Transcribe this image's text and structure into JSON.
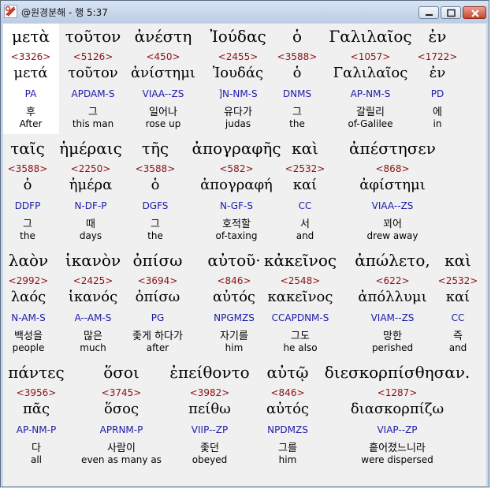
{
  "window": {
    "title": "@원경분해 - 행 5:37"
  },
  "rows": [
    [
      {
        "greek": "μετὰ",
        "strong": "<3326>",
        "lemma": "μετά",
        "pos": "PA",
        "korean": "후",
        "english": "After"
      },
      {
        "greek": "τοῦτον",
        "strong": "<5126>",
        "lemma": "τοῦτον",
        "pos": "APDAM-S",
        "korean": "그",
        "english": "this man"
      },
      {
        "greek": "ἀνέστη",
        "strong": "<450>",
        "lemma": "ἀνίστημι",
        "pos": "VIAA--ZS",
        "korean": "일어나",
        "english": "rose up"
      },
      {
        "greek": "Ἰούδας",
        "strong": "<2455>",
        "lemma": "Ἰουδάς",
        "pos": "]N-NM-S",
        "korean": "유다가",
        "english": "judas"
      },
      {
        "greek": "ὁ",
        "strong": "<3588>",
        "lemma": "ὁ",
        "pos": "DNMS",
        "korean": "그",
        "english": "the"
      },
      {
        "greek": "Γαλιλαῖος",
        "strong": "<1057>",
        "lemma": "Γαλιλαῖος",
        "pos": "AP-NM-S",
        "korean": "갈릴리",
        "english": "of-Galilee"
      },
      {
        "greek": "ἐν",
        "strong": "<1722>",
        "lemma": "ἐν",
        "pos": "PD",
        "korean": "에",
        "english": "in"
      }
    ],
    [
      {
        "greek": "ταῖς",
        "strong": "<3588>",
        "lemma": "ὁ",
        "pos": "DDFP",
        "korean": "그",
        "english": "the"
      },
      {
        "greek": "ἡμέραις",
        "strong": "<2250>",
        "lemma": "ἡμέρα",
        "pos": "N-DF-P",
        "korean": "때",
        "english": "days"
      },
      {
        "greek": "τῆς",
        "strong": "<3588>",
        "lemma": "ὁ",
        "pos": "DGFS",
        "korean": "그",
        "english": "the"
      },
      {
        "greek": "ἀπογραφῆς",
        "strong": "<582>",
        "lemma": "ἀπογραφή",
        "pos": "N-GF-S",
        "korean": "호적할",
        "english": "of-taxing"
      },
      {
        "greek": "καὶ",
        "strong": "<2532>",
        "lemma": "καί",
        "pos": "CC",
        "korean": "서",
        "english": "and"
      },
      {
        "greek": "ἀπέστησεν",
        "strong": "<868>",
        "lemma": "ἀφίστημι",
        "pos": "VIAA--ZS",
        "korean": "꾀어",
        "english": "drew away"
      }
    ],
    [
      {
        "greek": "λαὸν",
        "strong": "<2992>",
        "lemma": "λαός",
        "pos": "N-AM-S",
        "korean": "백성을",
        "english": "people"
      },
      {
        "greek": "ἱκανὸν",
        "strong": "<2425>",
        "lemma": "ἱκανός",
        "pos": "A--AM-S",
        "korean": "많은",
        "english": "much"
      },
      {
        "greek": "ὀπίσω",
        "strong": "<3694>",
        "lemma": "ὀπίσω",
        "pos": "PG",
        "korean": "좇게 하다가",
        "english": "after"
      },
      {
        "greek": "αὐτοῦ·",
        "strong": "<846>",
        "lemma": "αὐτός",
        "pos": "NPGMZS",
        "korean": "자기를",
        "english": "him"
      },
      {
        "greek": "κἀκεῖνος",
        "strong": "<2548>",
        "lemma": "κακεῖνος",
        "pos": "CCAPDNM-S",
        "korean": "그도",
        "english": "he also"
      },
      {
        "greek": "ἀπώλετο,",
        "strong": "<622>",
        "lemma": "ἀπόλλυμι",
        "pos": "VIAM--ZS",
        "korean": "망한",
        "english": "perished"
      },
      {
        "greek": "καὶ",
        "strong": "<2532>",
        "lemma": "καί",
        "pos": "CC",
        "korean": "즉",
        "english": "and"
      }
    ],
    [
      {
        "greek": "πάντες",
        "strong": "<3956>",
        "lemma": "πᾶς",
        "pos": "AP-NM-P",
        "korean": "다",
        "english": "all"
      },
      {
        "greek": "ὅσοι",
        "strong": "<3745>",
        "lemma": "ὅσος",
        "pos": "APRNM-P",
        "korean": "사람이",
        "english": "even as many as"
      },
      {
        "greek": "ἐπείθοντο",
        "strong": "<3982>",
        "lemma": "πείθω",
        "pos": "VIIP--ZP",
        "korean": "좇던",
        "english": "obeyed"
      },
      {
        "greek": "αὐτῷ",
        "strong": "<846>",
        "lemma": "αὐτός",
        "pos": "NPDMZS",
        "korean": "그를",
        "english": "him"
      },
      {
        "greek": "διεσκορπίσθησαν.",
        "strong": "<1287>",
        "lemma": "διασκορπίζω",
        "pos": "VIAP--ZP",
        "korean": "흩어졌느니라",
        "english": "were dispersed"
      }
    ]
  ]
}
